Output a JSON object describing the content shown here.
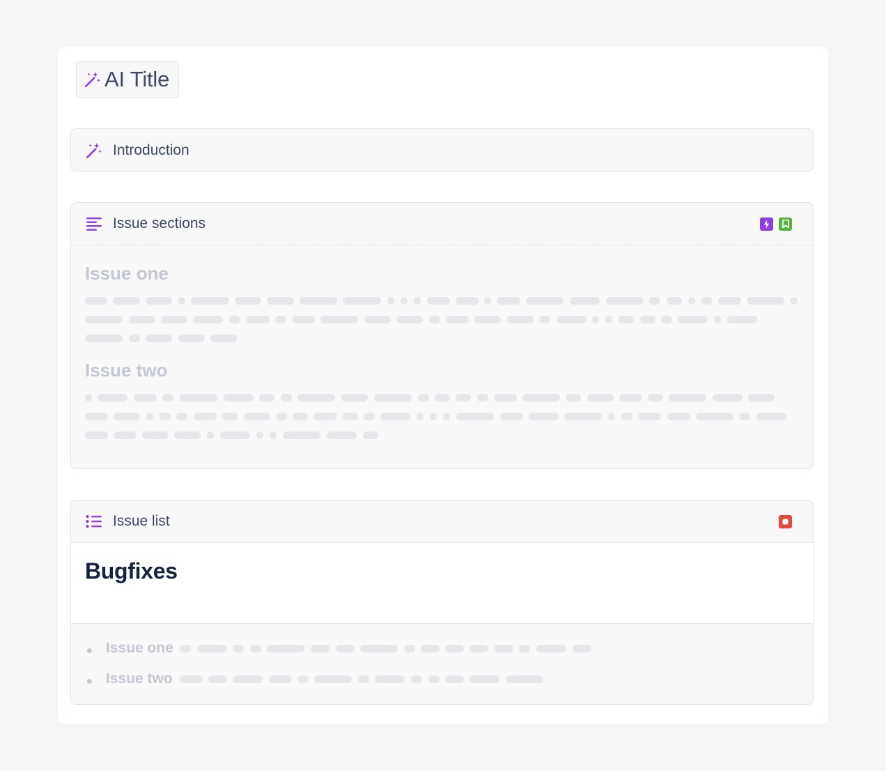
{
  "title": "AI Title",
  "panels": {
    "introduction": {
      "label": "Introduction"
    },
    "issue_sections": {
      "label": "Issue sections",
      "items": [
        {
          "heading": "Issue one"
        },
        {
          "heading": "Issue two"
        }
      ],
      "badge_colors": [
        "#8b3fe0",
        "#53b83a"
      ]
    },
    "issue_list": {
      "label": "Issue list",
      "heading": "Bugfixes",
      "items": [
        "Issue one",
        "Issue two"
      ],
      "badge_colors": [
        "#e5483a"
      ]
    }
  },
  "colors": {
    "accent": "#8b3fe0",
    "heading_dark": "#15233f",
    "label": "#3e4a63"
  }
}
